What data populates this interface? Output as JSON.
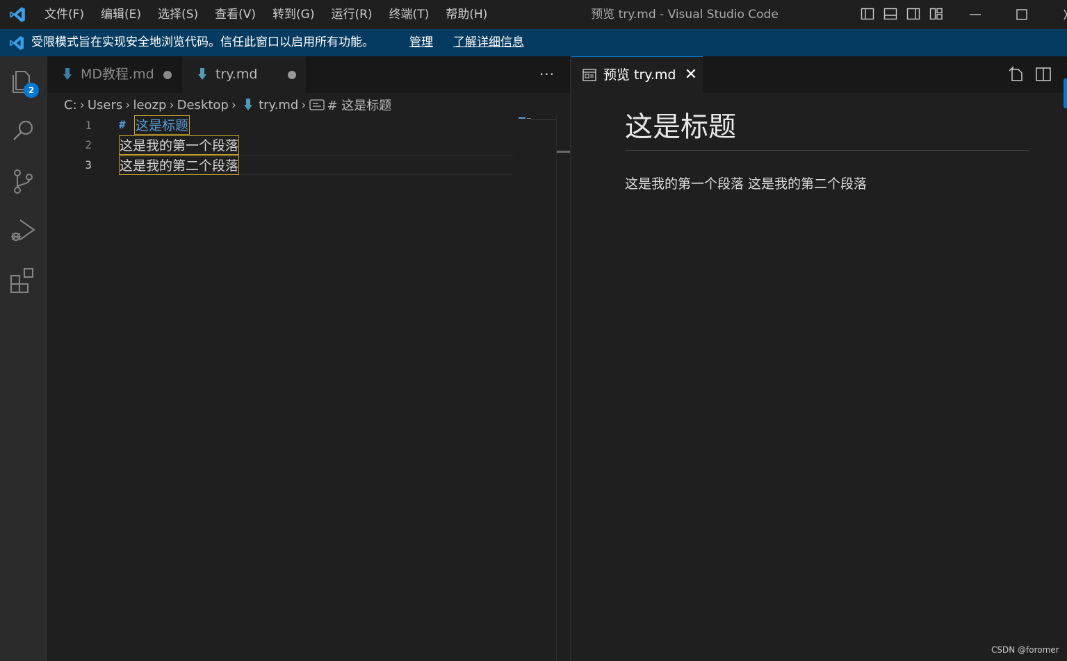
{
  "titlebar": {
    "menu": [
      "文件(F)",
      "编辑(E)",
      "选择(S)",
      "查看(V)",
      "转到(G)",
      "运行(R)",
      "终端(T)",
      "帮助(H)"
    ],
    "window_title": "预览 try.md - Visual Studio Code",
    "icons": [
      "vscode-logo-icon",
      "toggle-primary-sidebar-icon",
      "toggle-panel-icon",
      "toggle-secondary-sidebar-icon",
      "customize-layout-icon",
      "minimize-icon",
      "maximize-icon",
      "close-icon"
    ]
  },
  "banner": {
    "message": "受限模式旨在实现安全地浏览代码。信任此窗口以启用所有功能。",
    "manage": "管理",
    "learn_more": "了解详细信息"
  },
  "activity": {
    "explorer_badge": "2",
    "icons": [
      "explorer-icon",
      "search-icon",
      "source-control-icon",
      "run-debug-icon",
      "extensions-icon"
    ]
  },
  "editor_left": {
    "tabs": [
      {
        "label": "MD教程.md",
        "dirty": true,
        "active": false
      },
      {
        "label": "try.md",
        "dirty": true,
        "active": true
      }
    ],
    "more": "···",
    "breadcrumb": [
      "C:",
      "Users",
      "leozp",
      "Desktop",
      "try.md",
      "# 这是标题"
    ],
    "lines": [
      {
        "number": "1",
        "hash": "#",
        "text": "这是标题"
      },
      {
        "number": "2",
        "text": "这是我的第一个段落"
      },
      {
        "number": "3",
        "text": "这是我的第二个段落"
      }
    ]
  },
  "editor_right": {
    "tab_label": "预览 try.md",
    "close": "✕",
    "preview": {
      "heading": "这是标题",
      "paragraph": "这是我的第一个段落 这是我的第二个段落"
    }
  },
  "colors": {
    "accent": "#0078d4",
    "banner": "#063b61",
    "heading_blue": "#569cd6",
    "highlight_border": "#c7a32b",
    "markdown_icon": "#519aba"
  },
  "watermark": "CSDN @foromer"
}
